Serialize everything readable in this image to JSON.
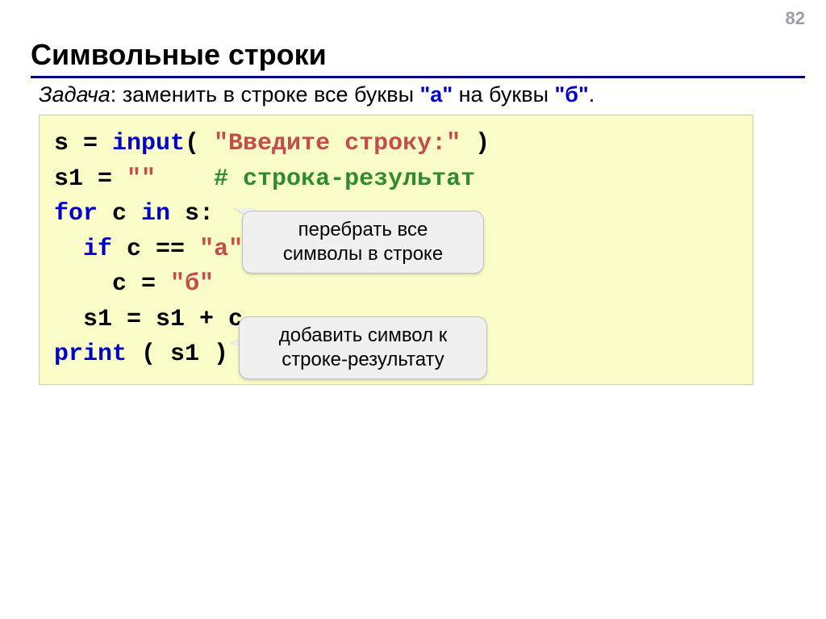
{
  "page_number": "82",
  "title": "Символьные строки",
  "problem": {
    "label": "Задача",
    "text_before": ": заменить в строке все буквы ",
    "a": "\"а\"",
    "between": " на буквы ",
    "b": "\"б\"",
    "after": "."
  },
  "code": {
    "l1a": "s = ",
    "l1b": "input",
    "l1c": "( ",
    "l1d": "\"Введите строку:\"",
    "l1e": " )",
    "l2a": "s1 = ",
    "l2b": "\"\"",
    "l2pad": "    ",
    "l2c": "# строка-результат",
    "l3a": "for",
    "l3b": " c ",
    "l3c": "in",
    "l3d": " s:",
    "l4pad": "  ",
    "l4a": "if",
    "l4b": " c == ",
    "l4c": "\"а\"",
    "l4d": ":",
    "l5pad": "    ",
    "l5a": "c = ",
    "l5b": "\"б\"",
    "l6pad": "  ",
    "l6a": "s1 = s1 + c",
    "l7a": "print",
    "l7b": " ( s1 )"
  },
  "callouts": {
    "c1_line1": "перебрать все",
    "c1_line2": "символы в строке",
    "c2_line1": "добавить символ к",
    "c2_line2": "строке-результату"
  }
}
